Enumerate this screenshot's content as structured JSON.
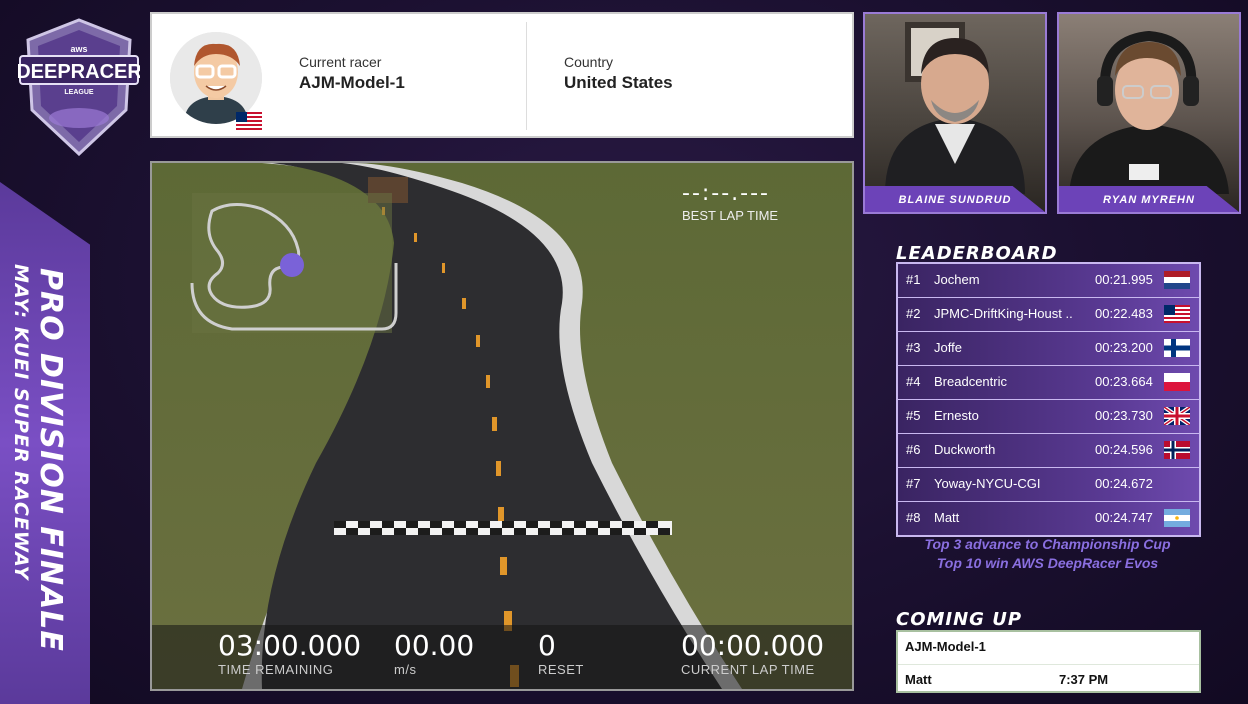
{
  "logo": {
    "top": "aws",
    "main": "DEEPRACER",
    "sub": "LEAGUE"
  },
  "side_banner": {
    "line1": "PRO DIVISION FINALE",
    "line2": "MAY: KUEI SUPER RACEWAY"
  },
  "racer": {
    "label": "Current racer",
    "name": "AJM-Model-1",
    "country_label": "Country",
    "country": "United States"
  },
  "hosts": [
    {
      "name": "BLAINE SUNDRUD"
    },
    {
      "name": "RYAN MYREHN"
    }
  ],
  "hud": {
    "best_lap_value": "--:--.---",
    "best_lap_label": "BEST LAP TIME",
    "time_remaining": "03:00.000",
    "time_remaining_label": "TIME REMAINING",
    "speed": "00.00",
    "speed_label": "m/s",
    "resets": "0",
    "resets_label": "RESET",
    "current_lap": "00:00.000",
    "current_lap_label": "CURRENT LAP TIME"
  },
  "leaderboard": {
    "title": "LEADERBOARD",
    "rows": [
      {
        "rank": "#1",
        "name": "Jochem",
        "time": "00:21.995",
        "flag": "nl"
      },
      {
        "rank": "#2",
        "name": "JPMC-DriftKing-Houst ..",
        "time": "00:22.483",
        "flag": "us"
      },
      {
        "rank": "#3",
        "name": "Joffe",
        "time": "00:23.200",
        "flag": "fi"
      },
      {
        "rank": "#4",
        "name": "Breadcentric",
        "time": "00:23.664",
        "flag": "pl"
      },
      {
        "rank": "#5",
        "name": "Ernesto",
        "time": "00:23.730",
        "flag": "gb"
      },
      {
        "rank": "#6",
        "name": "Duckworth",
        "time": "00:24.596",
        "flag": "no"
      },
      {
        "rank": "#7",
        "name": "Yoway-NYCU-CGI",
        "time": "00:24.672",
        "flag": ""
      },
      {
        "rank": "#8",
        "name": "Matt",
        "time": "00:24.747",
        "flag": "ar"
      }
    ],
    "promo_line1": "Top 3 advance to Championship Cup",
    "promo_line2": "Top 10 win AWS DeepRacer Evos"
  },
  "coming_up": {
    "title": "COMING UP",
    "items": [
      {
        "name": "AJM-Model-1",
        "time": ""
      },
      {
        "name": "Matt",
        "time": "7:37 PM"
      }
    ]
  },
  "colors": {
    "accent": "#6c43b8",
    "bg": "#1b1030",
    "promo": "#8a6fe0"
  }
}
